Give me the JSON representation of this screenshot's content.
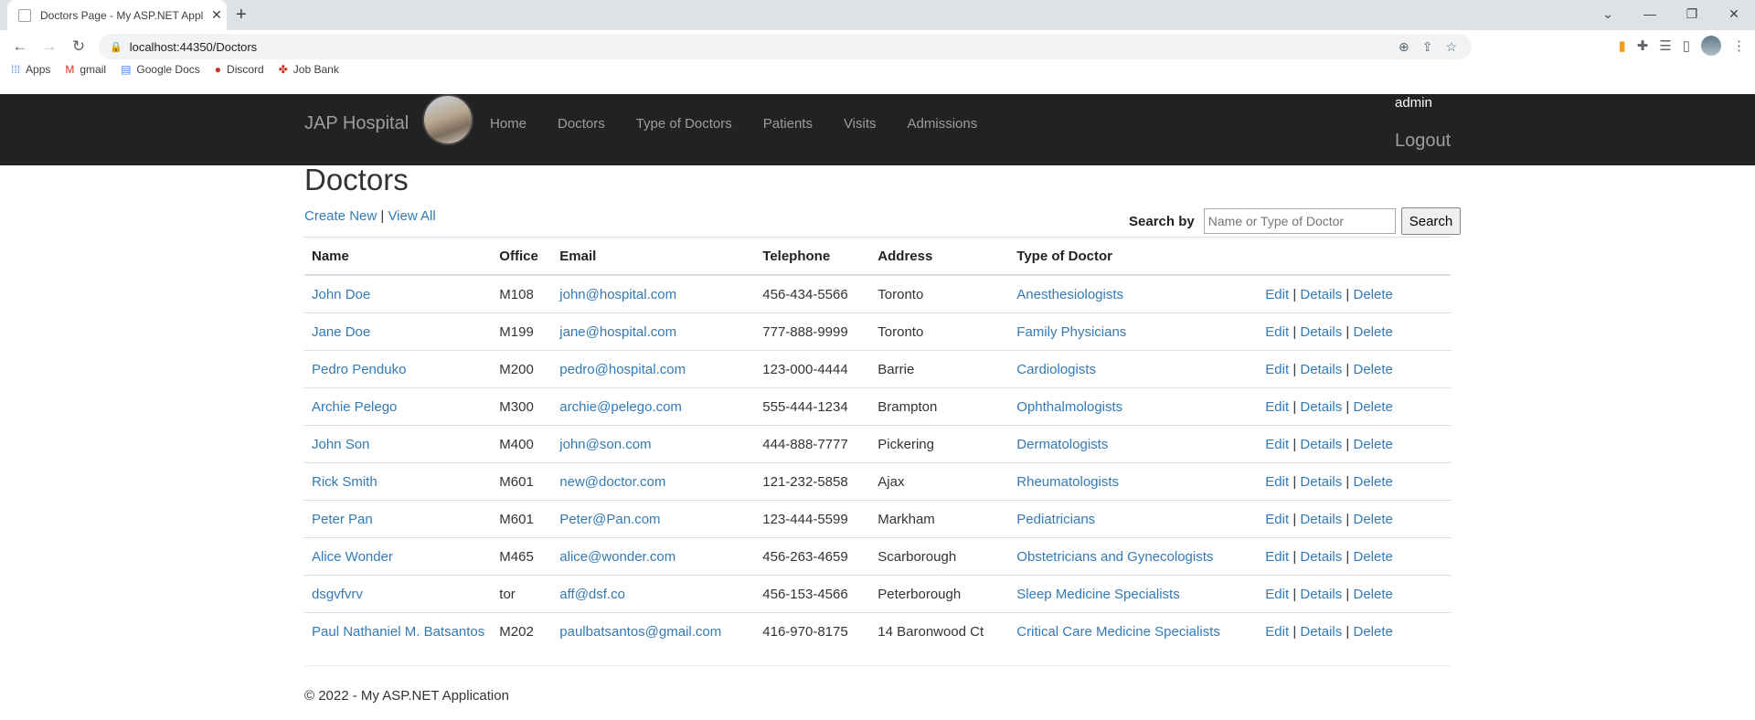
{
  "browser": {
    "tab_title": "Doctors Page - My ASP.NET Appl",
    "url": "localhost:44350/Doctors",
    "bookmarks": [
      {
        "label": "Apps",
        "icon": "apps-grid-icon"
      },
      {
        "label": "gmail",
        "icon": "gmail-icon"
      },
      {
        "label": "Google Docs",
        "icon": "docs-icon"
      },
      {
        "label": "Discord",
        "icon": "discord-icon"
      },
      {
        "label": "Job Bank",
        "icon": "maple-leaf-icon"
      }
    ]
  },
  "navbar": {
    "brand": "JAP Hospital",
    "links": [
      "Home",
      "Doctors",
      "Type of Doctors",
      "Patients",
      "Visits",
      "Admissions"
    ],
    "user": "admin",
    "logout": "Logout"
  },
  "page": {
    "title": "Doctors",
    "create_new": "Create New",
    "separator": "|",
    "view_all": "View All",
    "search_label": "Search by",
    "search_placeholder": "Name or Type of Doctor",
    "search_button": "Search"
  },
  "table": {
    "headers": [
      "Name",
      "Office",
      "Email",
      "Telephone",
      "Address",
      "Type of Doctor"
    ],
    "actions": {
      "edit": "Edit",
      "details": "Details",
      "delete": "Delete"
    },
    "rows": [
      {
        "name": "John Doe",
        "office": "M108",
        "email": "john@hospital.com",
        "telephone": "456-434-5566",
        "address": "Toronto",
        "type": "Anesthesiologists"
      },
      {
        "name": "Jane Doe",
        "office": "M199",
        "email": "jane@hospital.com",
        "telephone": "777-888-9999",
        "address": "Toronto",
        "type": "Family Physicians"
      },
      {
        "name": "Pedro Penduko",
        "office": "M200",
        "email": "pedro@hospital.com",
        "telephone": "123-000-4444",
        "address": "Barrie",
        "type": "Cardiologists"
      },
      {
        "name": "Archie Pelego",
        "office": "M300",
        "email": "archie@pelego.com",
        "telephone": "555-444-1234",
        "address": "Brampton",
        "type": "Ophthalmologists"
      },
      {
        "name": "John Son",
        "office": "M400",
        "email": "john@son.com",
        "telephone": "444-888-7777",
        "address": "Pickering",
        "type": "Dermatologists"
      },
      {
        "name": "Rick Smith",
        "office": "M601",
        "email": "new@doctor.com",
        "telephone": "121-232-5858",
        "address": "Ajax",
        "type": "Rheumatologists"
      },
      {
        "name": "Peter Pan",
        "office": "M601",
        "email": "Peter@Pan.com",
        "telephone": "123-444-5599",
        "address": "Markham",
        "type": "Pediatricians"
      },
      {
        "name": "Alice Wonder",
        "office": "M465",
        "email": "alice@wonder.com",
        "telephone": "456-263-4659",
        "address": "Scarborough",
        "type": "Obstetricians and Gynecologists"
      },
      {
        "name": "dsgvfvrv",
        "office": "tor",
        "email": "aff@dsf.co",
        "telephone": "456-153-4566",
        "address": "Peterborough",
        "type": "Sleep Medicine Specialists"
      },
      {
        "name": "Paul Nathaniel M. Batsantos",
        "office": "M202",
        "email": "paulbatsantos@gmail.com",
        "telephone": "416-970-8175",
        "address": "14 Baronwood Ct",
        "type": "Critical Care Medicine Specialists"
      }
    ]
  },
  "footer": {
    "text": "© 2022 - My ASP.NET Application"
  }
}
